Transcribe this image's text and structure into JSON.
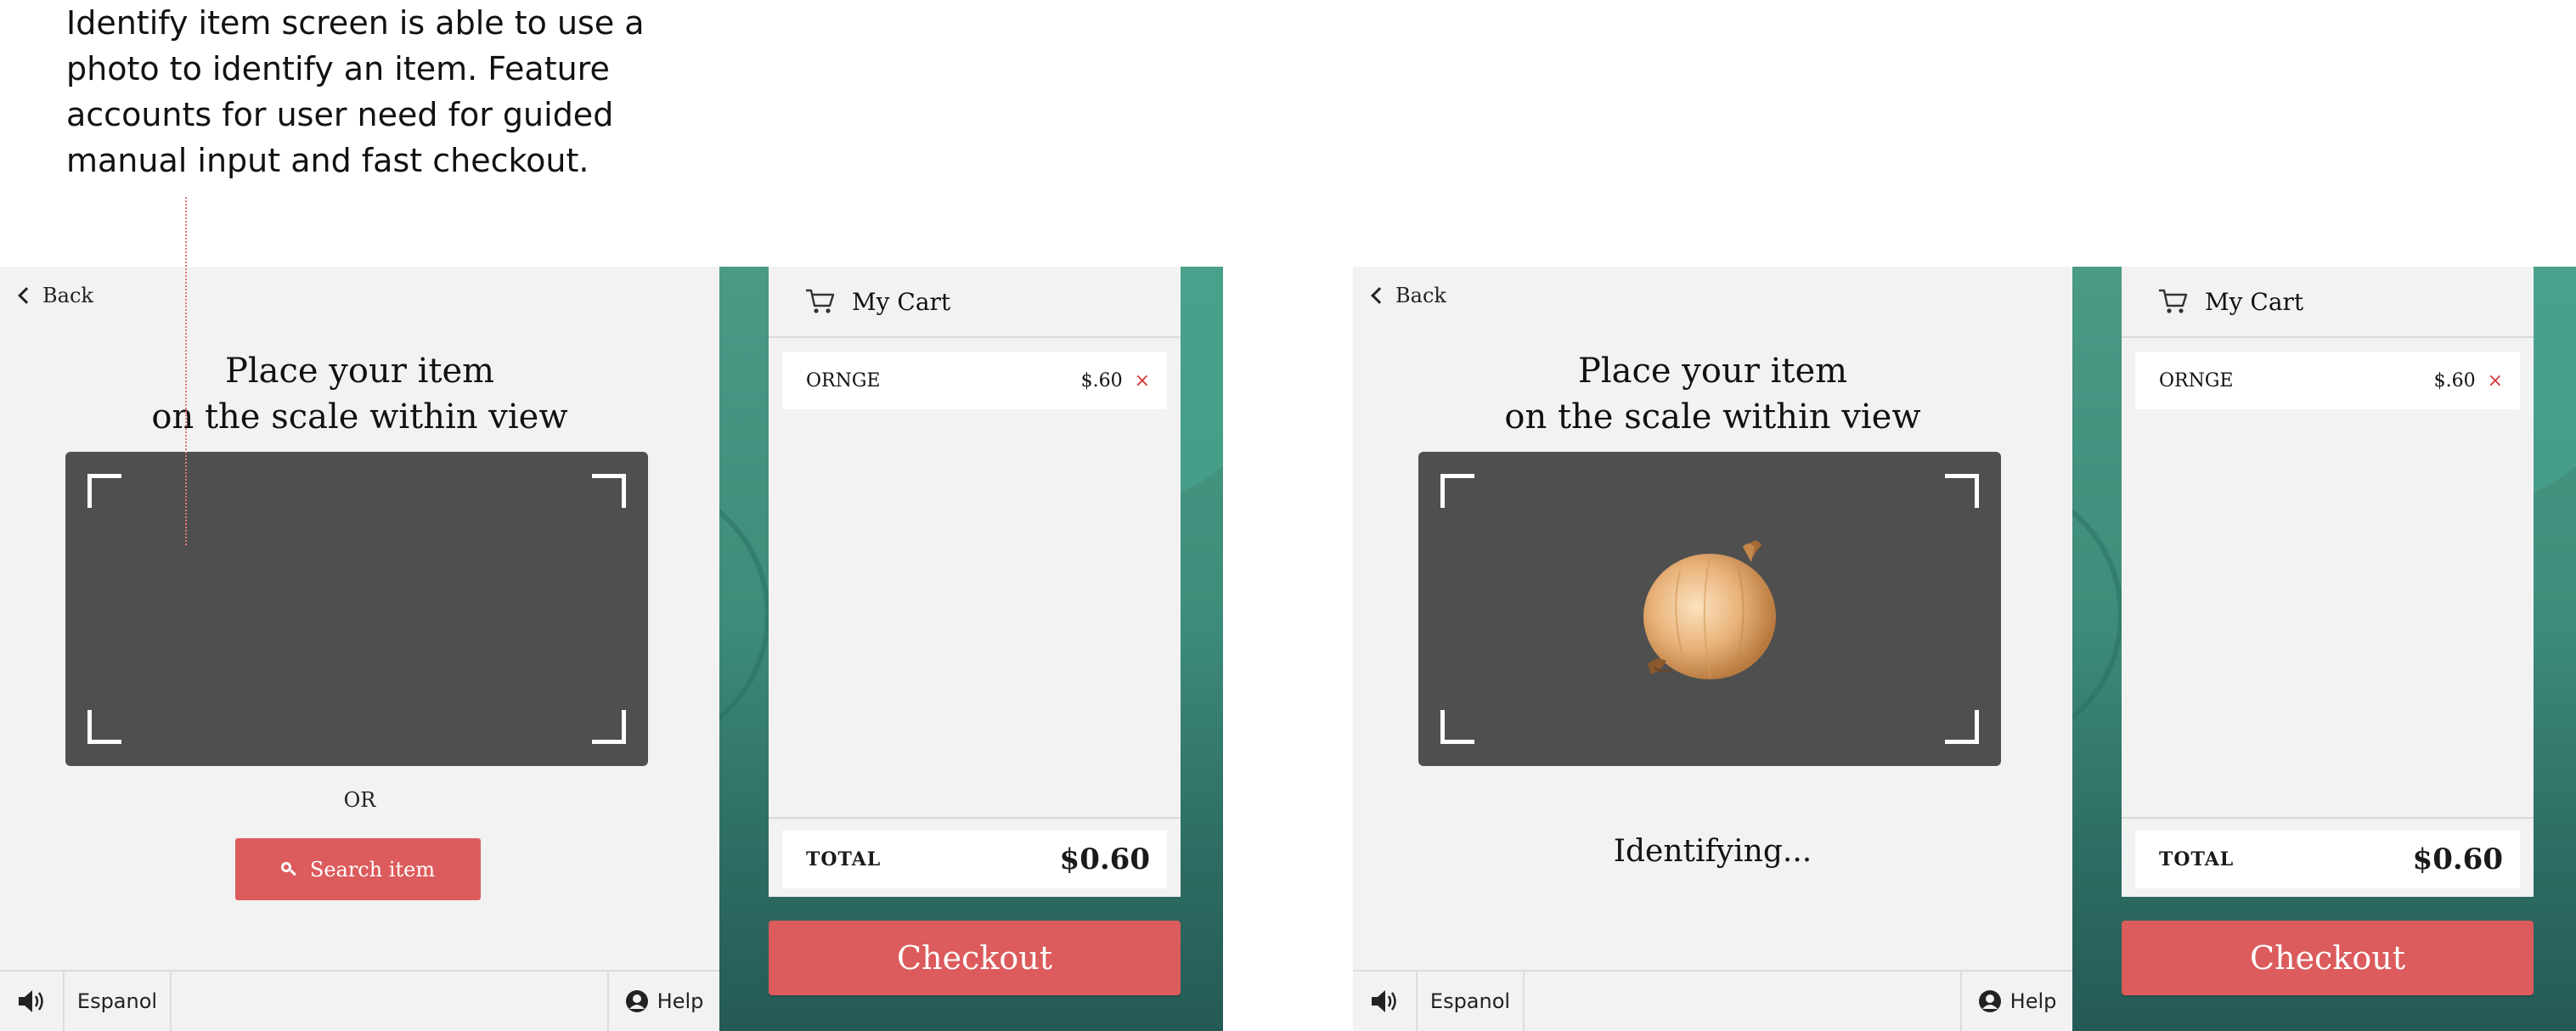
{
  "annotation": {
    "lines": [
      "Identify item screen is able to use a",
      "photo to identify an item. Feature",
      "accounts for user need for guided",
      "manual input and fast checkout."
    ]
  },
  "colors": {
    "accent_red": "#dc5b5c",
    "sidebar_green": "#3e8d7a",
    "viewer_gray": "#4f4f4f",
    "remove_red": "#d83a3a"
  },
  "screens": [
    {
      "back_label": "Back",
      "title_line1": "Place your item",
      "title_line2": "on the scale within view",
      "or_label": "OR",
      "search_label": "Search item",
      "sound_icon": "speaker-icon",
      "language_label": "Espanol",
      "help_label": "Help",
      "cart": {
        "title": "My Cart",
        "items": [
          {
            "name": "ORNGE",
            "price": "$.60",
            "remove": "×"
          }
        ],
        "total_label": "TOTAL",
        "total_value": "$0.60"
      },
      "checkout_label": "Checkout"
    },
    {
      "back_label": "Back",
      "title_line1": "Place your item",
      "title_line2": "on the scale within view",
      "status_label": "Identifying...",
      "sound_icon": "speaker-icon",
      "language_label": "Espanol",
      "help_label": "Help",
      "cart": {
        "title": "My Cart",
        "items": [
          {
            "name": "ORNGE",
            "price": "$.60",
            "remove": "×"
          }
        ],
        "total_label": "TOTAL",
        "total_value": "$0.60"
      },
      "checkout_label": "Checkout"
    }
  ]
}
